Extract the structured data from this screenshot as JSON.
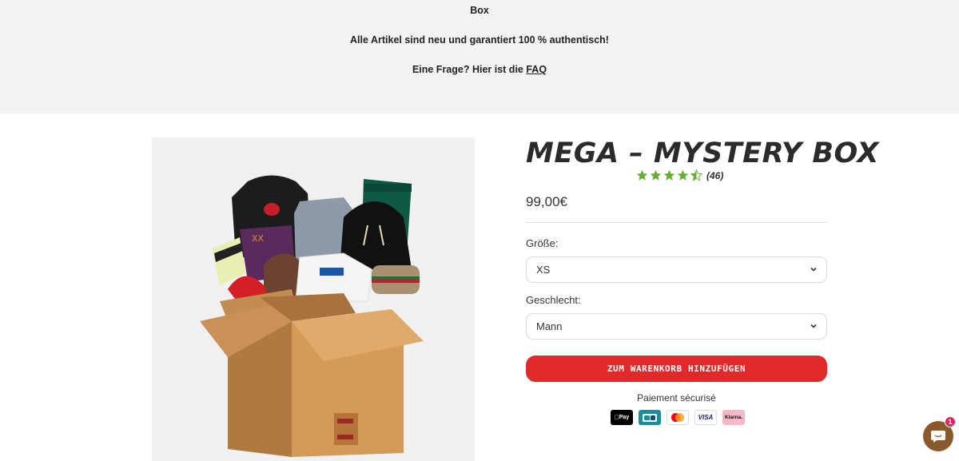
{
  "announcement": {
    "line1": "Box",
    "line2": "Alle Artikel sind neu und garantiert 100 % authentisch!",
    "line3_prefix": "Eine Frage? Hier ist die ",
    "line3_link": "FAQ"
  },
  "product": {
    "title": "MEGA – MYSTERY BOX",
    "rating": 4.5,
    "rating_count": "(46)",
    "price": "99,00€",
    "size_label": "Größe:",
    "size_value": "XS",
    "gender_label": "Geschlecht:",
    "gender_value": "Mann",
    "add_to_cart": "ZUM WARENKORB HINZUFÜGEN",
    "secure_payment": "Paiement sécurisé",
    "payment_methods": [
      "Pay",
      "CB",
      "",
      "VISA",
      "Klarna."
    ]
  },
  "colors": {
    "accent_red": "#e02a2a",
    "star_green": "#62b030",
    "chat_brown": "#8b5a2b"
  },
  "chat": {
    "badge": "1"
  }
}
